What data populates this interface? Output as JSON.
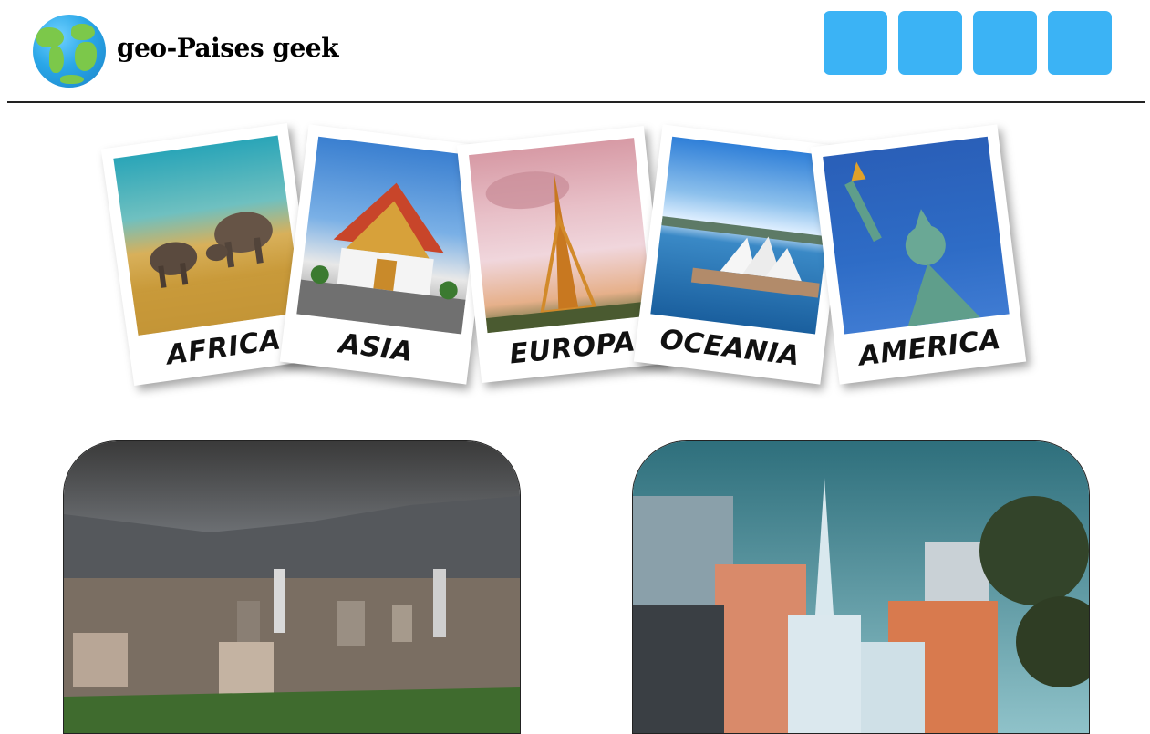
{
  "header": {
    "brand_title": "geo-Paises geek",
    "logo_icon": "globe-icon",
    "nav_buttons": [
      {
        "name": "nav-button-1",
        "color": "#3bb3f5"
      },
      {
        "name": "nav-button-2",
        "color": "#3bb3f5"
      },
      {
        "name": "nav-button-3",
        "color": "#3bb3f5"
      },
      {
        "name": "nav-button-4",
        "color": "#3bb3f5"
      }
    ]
  },
  "continents": [
    {
      "label": "AFRICA",
      "image": "elephants-savanna"
    },
    {
      "label": "ASIA",
      "image": "thai-temple"
    },
    {
      "label": "EUROPA",
      "image": "eiffel-tower"
    },
    {
      "label": "OCEANIA",
      "image": "sydney-opera-house"
    },
    {
      "label": "AMERICA",
      "image": "statue-of-liberty"
    }
  ],
  "featured_cities": [
    {
      "image": "medellin-skyline"
    },
    {
      "image": "cali-church-ermita"
    }
  ]
}
